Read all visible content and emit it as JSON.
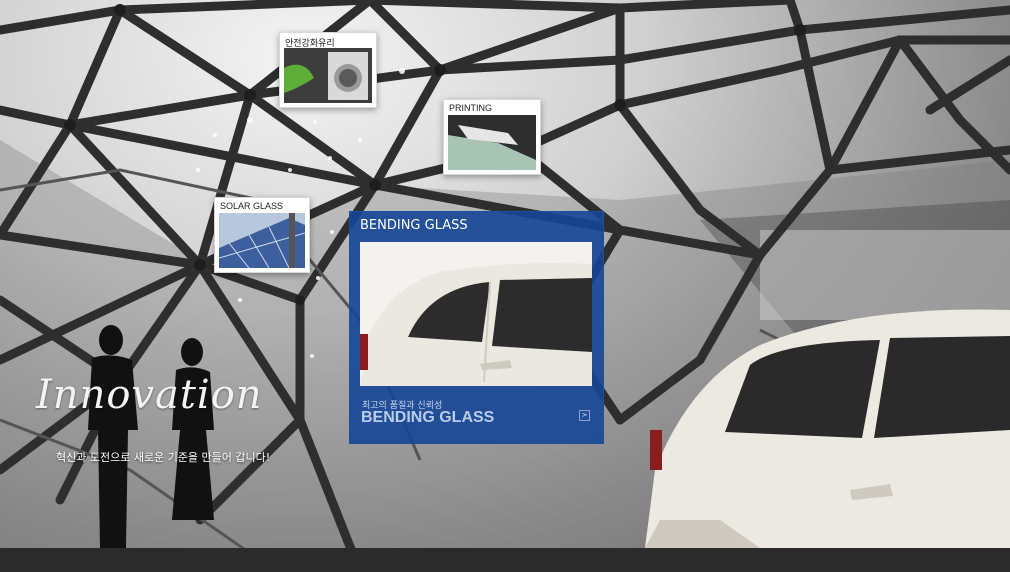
{
  "thumbnails": [
    {
      "label": "안전강화유리"
    },
    {
      "label": "PRINTING"
    },
    {
      "label": "SOLAR GLASS"
    }
  ],
  "feature": {
    "title": "BENDING GLASS",
    "subtitle": "최고의 품질과 신뢰성",
    "name": "BENDING GLASS",
    "arrow": ">"
  },
  "hero": {
    "heading": "Innovation",
    "tagline": "혁신과 도전으로 새로운 기준을 만들어 갑니다!"
  },
  "colors": {
    "feature_panel": "#1c4a98",
    "background": "#8d8d8d"
  }
}
